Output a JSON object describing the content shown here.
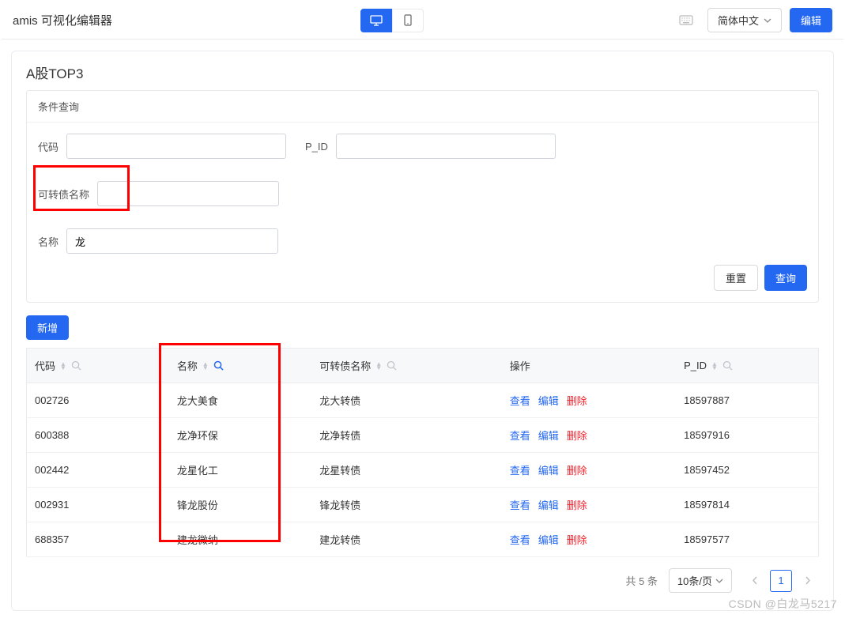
{
  "topbar": {
    "title": "amis 可视化编辑器",
    "lang_label": "简体中文",
    "edit_label": "编辑"
  },
  "panel": {
    "title": "A股TOP3"
  },
  "filter": {
    "title": "条件查询",
    "code_label": "代码",
    "code_value": "",
    "pid_label": "P_ID",
    "pid_value": "",
    "bond_label": "可转债名称",
    "bond_value": "",
    "name_label": "名称",
    "name_value": "龙",
    "reset_label": "重置",
    "query_label": "查询"
  },
  "toolbar": {
    "add_label": "新增"
  },
  "table": {
    "columns": {
      "code": "代码",
      "name": "名称",
      "bond": "可转债名称",
      "ops": "操作",
      "pid": "P_ID"
    },
    "ops": {
      "view": "查看",
      "edit": "编辑",
      "delete": "删除"
    },
    "rows": [
      {
        "code": "002726",
        "name": "龙大美食",
        "bond": "龙大转债",
        "pid": "18597887"
      },
      {
        "code": "600388",
        "name": "龙净环保",
        "bond": "龙净转债",
        "pid": "18597916"
      },
      {
        "code": "002442",
        "name": "龙星化工",
        "bond": "龙星转债",
        "pid": "18597452"
      },
      {
        "code": "002931",
        "name": "锋龙股份",
        "bond": "锋龙转债",
        "pid": "18597814"
      },
      {
        "code": "688357",
        "name": "建龙微纳",
        "bond": "建龙转债",
        "pid": "18597577"
      }
    ]
  },
  "pagination": {
    "total_text": "共 5 条",
    "page_size_label": "10条/页",
    "current_page": "1"
  },
  "watermark": "CSDN @白龙马5217"
}
